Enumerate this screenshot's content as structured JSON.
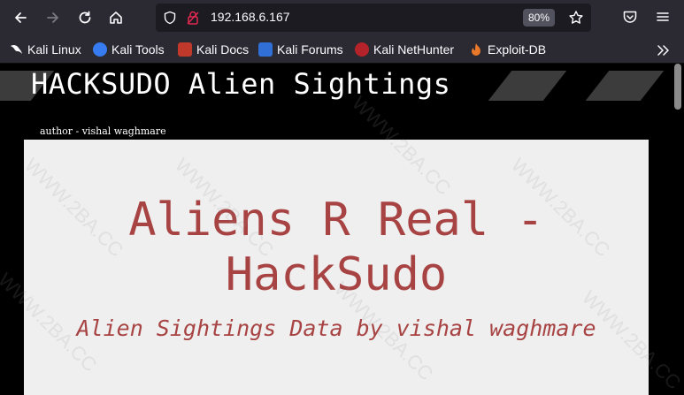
{
  "browser": {
    "url": "192.168.6.167",
    "zoom": "80%",
    "bookmarks": [
      {
        "label": "Kali Linux",
        "icon": "kali-dragon-icon"
      },
      {
        "label": "Kali Tools",
        "icon": "kali-tools-icon"
      },
      {
        "label": "Kali Docs",
        "icon": "kali-docs-icon"
      },
      {
        "label": "Kali Forums",
        "icon": "kali-forums-icon"
      },
      {
        "label": "Kali NetHunter",
        "icon": "kali-nethunter-icon"
      },
      {
        "label": "Exploit-DB",
        "icon": "exploit-db-icon"
      }
    ]
  },
  "page": {
    "title": "HACKSUDO Alien Sightings",
    "author": "author - vishal waghmare",
    "heading_line1": "Aliens R Real -",
    "heading_line2": "HackSudo",
    "subheading": "Alien Sightings Data by vishal waghmare"
  },
  "colors": {
    "accent": "#a84343",
    "panel": "#efefef",
    "background": "#000000"
  }
}
